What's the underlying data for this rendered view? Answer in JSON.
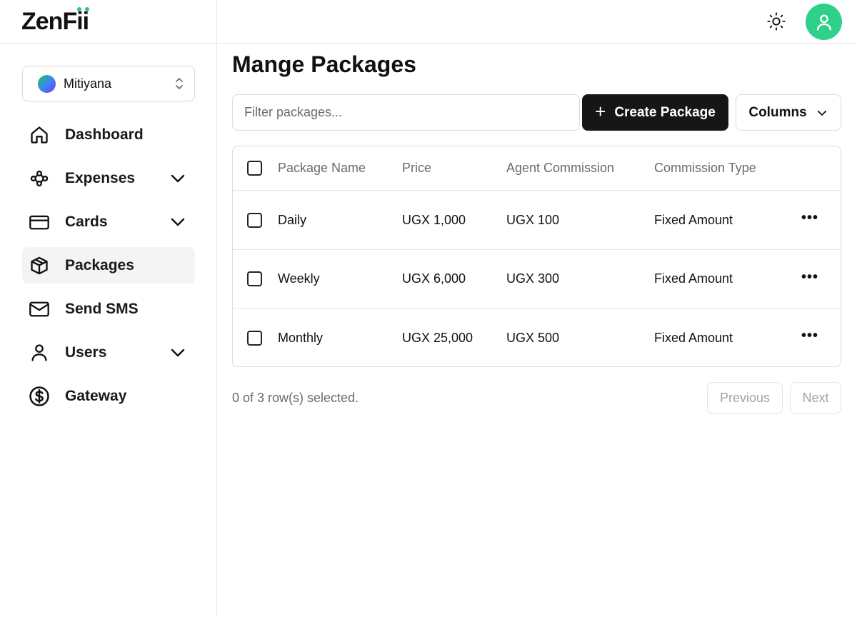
{
  "brand": {
    "name_prefix": "ZenF",
    "name_suffix": "ii",
    "accent_color": "#2fc77a"
  },
  "workspace": {
    "name": "Mitiyana"
  },
  "sidebar": {
    "items": [
      {
        "label": "Dashboard",
        "icon": "home-icon",
        "has_chevron": false,
        "active": false
      },
      {
        "label": "Expenses",
        "icon": "workflow-icon",
        "has_chevron": true,
        "active": false
      },
      {
        "label": "Cards",
        "icon": "credit-card-icon",
        "has_chevron": true,
        "active": false
      },
      {
        "label": "Packages",
        "icon": "package-icon",
        "has_chevron": false,
        "active": true
      },
      {
        "label": "Send SMS",
        "icon": "mail-icon",
        "has_chevron": false,
        "active": false
      },
      {
        "label": "Users",
        "icon": "user-icon",
        "has_chevron": true,
        "active": false
      },
      {
        "label": "Gateway",
        "icon": "dollar-circle-icon",
        "has_chevron": false,
        "active": false
      }
    ]
  },
  "header": {
    "theme_toggle_icon": "sun-icon",
    "avatar_icon": "user-icon",
    "avatar_color": "#2fd08a"
  },
  "page": {
    "title": "Mange Packages",
    "filter_placeholder": "Filter packages...",
    "create_label": "Create Package",
    "columns_label": "Columns"
  },
  "table": {
    "columns": [
      "Package Name",
      "Price",
      "Agent Commission",
      "Commission Type"
    ],
    "rows": [
      {
        "name": "Daily",
        "price": "UGX 1,000",
        "commission": "UGX 100",
        "type": "Fixed Amount"
      },
      {
        "name": "Weekly",
        "price": "UGX 6,000",
        "commission": "UGX 300",
        "type": "Fixed Amount"
      },
      {
        "name": "Monthly",
        "price": "UGX 25,000",
        "commission": "UGX 500",
        "type": "Fixed Amount"
      }
    ],
    "row_action": "•••"
  },
  "footer": {
    "selection_text": "0 of 3 row(s) selected.",
    "previous_label": "Previous",
    "next_label": "Next"
  }
}
